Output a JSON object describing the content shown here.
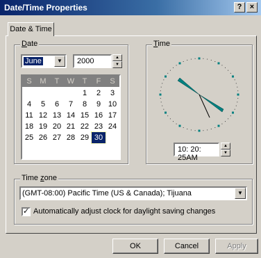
{
  "window": {
    "title": "Date/Time Properties",
    "help_label": "?",
    "close_label": "×"
  },
  "tab": {
    "label": "Date & Time"
  },
  "date": {
    "group_label_accel": "D",
    "group_label_rest": "ate",
    "month": "June",
    "year": "2000",
    "weekday_headers": [
      "S",
      "M",
      "T",
      "W",
      "T",
      "F",
      "S"
    ],
    "days": [
      [
        "",
        "",
        "",
        "",
        "1",
        "2",
        "3"
      ],
      [
        "4",
        "5",
        "6",
        "7",
        "8",
        "9",
        "10"
      ],
      [
        "11",
        "12",
        "13",
        "14",
        "15",
        "16",
        "17"
      ],
      [
        "18",
        "19",
        "20",
        "21",
        "22",
        "23",
        "24"
      ],
      [
        "25",
        "26",
        "27",
        "28",
        "29",
        "30",
        ""
      ]
    ],
    "selected_day": "30"
  },
  "time": {
    "group_label_accel": "T",
    "group_label_rest": "ime",
    "value": "10: 20: 25AM"
  },
  "timezone": {
    "group_label_pre": "Time ",
    "group_label_accel": "z",
    "group_label_rest": "one",
    "value": "(GMT-08:00) Pacific Time (US & Canada); Tijuana",
    "dst_label": "Automatically adjust clock for daylight saving changes",
    "dst_checked": true
  },
  "buttons": {
    "ok": "OK",
    "cancel": "Cancel",
    "apply": "Apply"
  },
  "colors": {
    "title_bar": "#0a246a",
    "face": "#d4d0c8",
    "selection": "#0a246a",
    "clock_hands": "#008080"
  }
}
